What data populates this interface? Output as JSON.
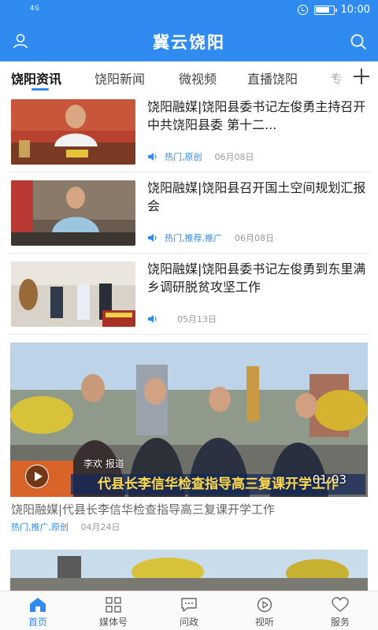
{
  "status_bar": {
    "signal": "4G",
    "time": "10:00",
    "icons": [
      "signal-icon",
      "alarm-icon",
      "battery-icon"
    ]
  },
  "header": {
    "title": "冀云饶阳",
    "left_icon": "user-icon",
    "right_icon": "search-icon"
  },
  "tabs": [
    {
      "label": "饶阳资讯",
      "active": true
    },
    {
      "label": "饶阳新闻",
      "active": false
    },
    {
      "label": "微视频",
      "active": false
    },
    {
      "label": "直播饶阳",
      "active": false
    },
    {
      "label": "专",
      "active": false
    }
  ],
  "add_tab_icon": "plus-icon",
  "news": [
    {
      "title": "饶阳融媒|饶阳县委书记左俊勇主持召开中共饶阳县委 第十二...",
      "tags": "热门,原创",
      "date": "06月08日"
    },
    {
      "title": "饶阳融媒|饶阳县召开国土空间规划汇报会",
      "tags": "热门,推荐,推广",
      "date": "06月08日"
    },
    {
      "title": "饶阳融媒|饶阳县委书记左俊勇到东里满乡调研脱贫攻坚工作",
      "tags": "",
      "date": "05月13日"
    }
  ],
  "video": {
    "caption": "代县长李信华检查指导高三复课开学工作",
    "reporter": "李欢 报道",
    "duration": "01:03",
    "title": "饶阳融媒|代县长李信华检查指导高三复课开学工作",
    "tags": "热门,推广,原创",
    "date": "04月24日"
  },
  "bottom_nav": [
    {
      "label": "首页",
      "icon": "home-icon",
      "active": true
    },
    {
      "label": "媒体号",
      "icon": "grid-icon",
      "active": false
    },
    {
      "label": "问政",
      "icon": "chat-icon",
      "active": false
    },
    {
      "label": "视听",
      "icon": "play-circle-icon",
      "active": false
    },
    {
      "label": "服务",
      "icon": "heart-icon",
      "active": false
    }
  ],
  "colors": {
    "brand": "#2f8bf0",
    "tag": "#2f8bf0",
    "date": "#999999"
  }
}
